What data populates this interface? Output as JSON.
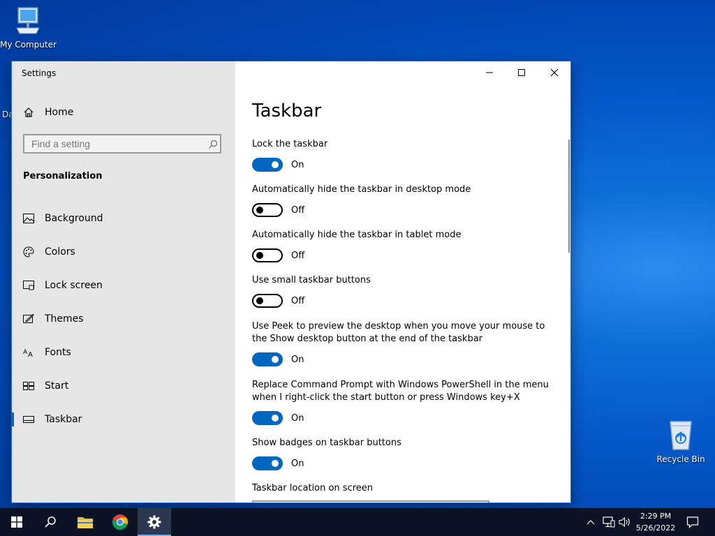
{
  "desktop": {
    "icons": [
      {
        "label": "My Computer"
      },
      {
        "label": "Recycle Bin"
      }
    ],
    "partial_label": "Da"
  },
  "window": {
    "title": "Settings"
  },
  "sidebar": {
    "home_label": "Home",
    "search_placeholder": "Find a setting",
    "section_title": "Personalization",
    "items": [
      {
        "label": "Background",
        "icon": "image-icon"
      },
      {
        "label": "Colors",
        "icon": "palette-icon"
      },
      {
        "label": "Lock screen",
        "icon": "lock-screen-icon"
      },
      {
        "label": "Themes",
        "icon": "brush-icon"
      },
      {
        "label": "Fonts",
        "icon": "font-icon"
      },
      {
        "label": "Start",
        "icon": "start-icon"
      },
      {
        "label": "Taskbar",
        "icon": "taskbar-icon",
        "selected": true
      }
    ]
  },
  "content": {
    "title": "Taskbar",
    "settings": [
      {
        "label": "Lock the taskbar",
        "state": "On"
      },
      {
        "label": "Automatically hide the taskbar in desktop mode",
        "state": "Off"
      },
      {
        "label": "Automatically hide the taskbar in tablet mode",
        "state": "Off"
      },
      {
        "label": "Use small taskbar buttons",
        "state": "Off"
      },
      {
        "label": "Use Peek to preview the desktop when you move your mouse to the Show desktop button at the end of the taskbar",
        "state": "On"
      },
      {
        "label": "Replace Command Prompt with Windows PowerShell in the menu when I right-click the start button or press Windows key+X",
        "state": "On"
      },
      {
        "label": "Show badges on taskbar buttons",
        "state": "On"
      }
    ],
    "location_label": "Taskbar location on screen"
  },
  "taskbar": {
    "time": "2:29 PM",
    "date": "5/26/2022",
    "apps": [
      "start-icon",
      "search-icon",
      "file-explorer-icon",
      "chrome-icon",
      "settings-icon"
    ]
  },
  "colors": {
    "accent": "#0067c0",
    "sidebar_bg": "#e6e6e6",
    "taskbar_bg": "#0b1325"
  }
}
